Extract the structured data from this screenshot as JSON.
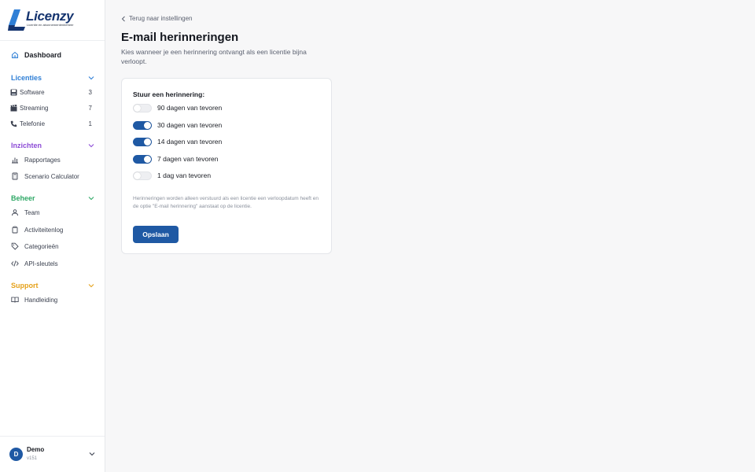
{
  "brand": {
    "name": "Licenzy",
    "tagline": "Licentie en abonnementenbeheer",
    "color": "#1f59a4"
  },
  "sidebar": {
    "dashboard": "Dashboard",
    "sections": [
      {
        "title": "Licenties",
        "color": "#2f7fd6",
        "items": [
          {
            "label": "Software",
            "count": "3",
            "icon": "floppy-disk-icon"
          },
          {
            "label": "Streaming",
            "count": "7",
            "icon": "clapperboard-icon"
          },
          {
            "label": "Telefonie",
            "count": "1",
            "icon": "phone-icon"
          }
        ]
      },
      {
        "title": "Inzichten",
        "color": "#8c4bd6",
        "items": [
          {
            "label": "Rapportages",
            "icon": "bar-chart-icon"
          },
          {
            "label": "Scenario Calculator",
            "icon": "calculator-icon"
          }
        ]
      },
      {
        "title": "Beheer",
        "color": "#2fa866",
        "items": [
          {
            "label": "Team",
            "icon": "users-icon"
          },
          {
            "label": "Activiteitenlog",
            "icon": "clipboard-icon"
          },
          {
            "label": "Categorieën",
            "icon": "tag-icon"
          },
          {
            "label": "API-sleutels",
            "icon": "code-icon"
          }
        ]
      },
      {
        "title": "Support",
        "color": "#e5a11a",
        "items": [
          {
            "label": "Handleiding",
            "icon": "book-icon"
          }
        ]
      }
    ],
    "user": {
      "initial": "D",
      "name": "Demo",
      "version": "v151"
    }
  },
  "main": {
    "back_label": "Terug naar instellingen",
    "title": "E-mail herinneringen",
    "subtitle": "Kies wanneer je een herinnering ontvangt als een licentie bijna verloopt.",
    "card": {
      "label": "Stuur een herinnering:",
      "options": [
        {
          "label": "90 dagen van tevoren",
          "enabled": false
        },
        {
          "label": "30 dagen van tevoren",
          "enabled": true
        },
        {
          "label": "14 dagen van tevoren",
          "enabled": true
        },
        {
          "label": "7 dagen van tevoren",
          "enabled": true
        },
        {
          "label": "1 dag van tevoren",
          "enabled": false
        }
      ],
      "note": "Herinneringen worden alleen verstuurd als een licentie een verloopdatum heeft en de optie \"E-mail herinnering\" aanstaat op de licentie.",
      "save_label": "Opslaan"
    }
  }
}
